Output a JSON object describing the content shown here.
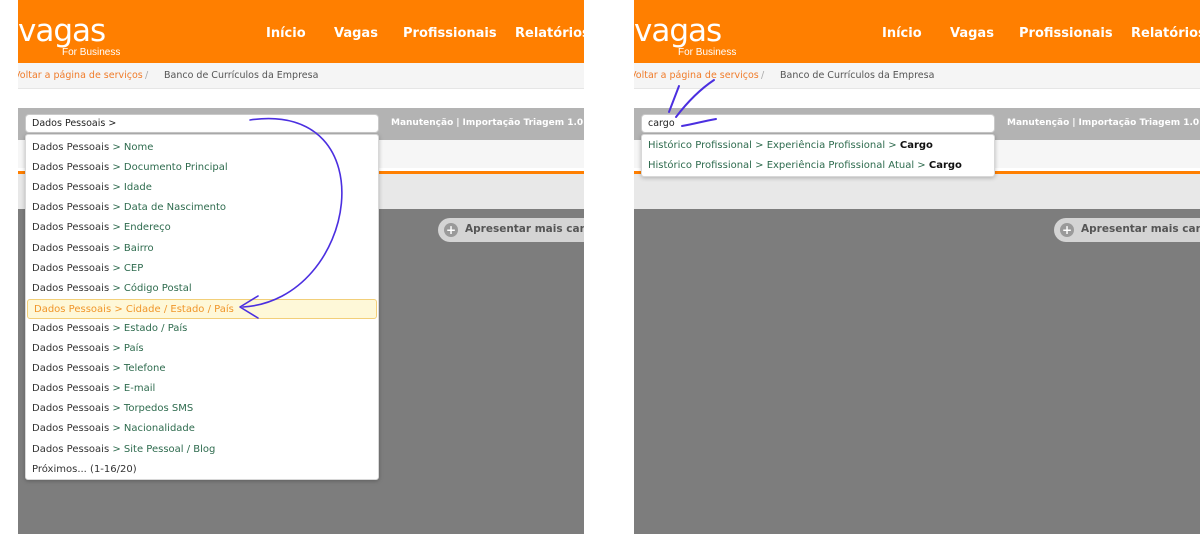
{
  "brand": {
    "name": "vagas",
    "tagline": "For Business",
    "header_color": "#ff7f00",
    "accent_link": "#f07c2a"
  },
  "nav": {
    "items": [
      "Início",
      "Vagas",
      "Profissionais",
      "Relatórios"
    ]
  },
  "breadcrumb": {
    "back": "Voltar a página de serviços",
    "separator": "/",
    "current": "Banco de Currículos da Empresa"
  },
  "toolbar": {
    "maintenance": "Manutenção",
    "separator": "|",
    "import": "Importação Triagem 1.0"
  },
  "more_button": {
    "label": "Apresentar mais candidatos",
    "icon": "plus-circle-icon"
  },
  "left_panel": {
    "search_value": "Dados Pessoais >",
    "suggestions": [
      {
        "parent": "Dados Pessoais",
        "child": "Nome",
        "highlighted": false
      },
      {
        "parent": "Dados Pessoais",
        "child": "Documento Principal",
        "highlighted": false
      },
      {
        "parent": "Dados Pessoais",
        "child": "Idade",
        "highlighted": false
      },
      {
        "parent": "Dados Pessoais",
        "child": "Data de Nascimento",
        "highlighted": false
      },
      {
        "parent": "Dados Pessoais",
        "child": "Endereço",
        "highlighted": false
      },
      {
        "parent": "Dados Pessoais",
        "child": "Bairro",
        "highlighted": false
      },
      {
        "parent": "Dados Pessoais",
        "child": "CEP",
        "highlighted": false
      },
      {
        "parent": "Dados Pessoais",
        "child": "Código Postal",
        "highlighted": false
      },
      {
        "parent": "Dados Pessoais",
        "child": "Cidade / Estado / País",
        "highlighted": true
      },
      {
        "parent": "Dados Pessoais",
        "child": "Estado / País",
        "highlighted": false
      },
      {
        "parent": "Dados Pessoais",
        "child": "País",
        "highlighted": false
      },
      {
        "parent": "Dados Pessoais",
        "child": "Telefone",
        "highlighted": false
      },
      {
        "parent": "Dados Pessoais",
        "child": "E-mail",
        "highlighted": false
      },
      {
        "parent": "Dados Pessoais",
        "child": "Torpedos SMS",
        "highlighted": false
      },
      {
        "parent": "Dados Pessoais",
        "child": "Nacionalidade",
        "highlighted": false
      },
      {
        "parent": "Dados Pessoais",
        "child": "Site Pessoal / Blog",
        "highlighted": false
      }
    ],
    "more": "Próximos... (1-16/20)"
  },
  "right_panel": {
    "search_value": "cargo",
    "suggestions": [
      {
        "path": "Histórico Profissional > Experiência Profissional > ",
        "match": "Cargo"
      },
      {
        "path": "Histórico Profissional > Experiência Profissional Atual > ",
        "match": "Cargo"
      }
    ]
  },
  "annotation_color": "#4b2fe0"
}
